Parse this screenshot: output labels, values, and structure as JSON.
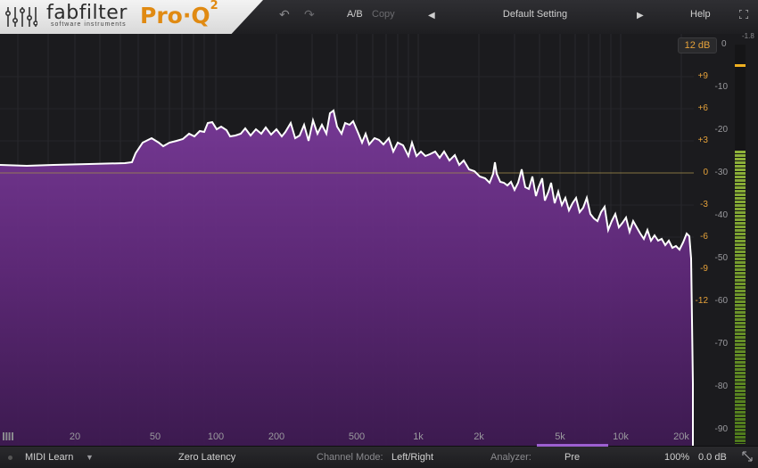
{
  "header": {
    "brand": "fabfilter",
    "brand_sub": "software instruments",
    "product": "Pro·Q",
    "product_version": "2",
    "ab_label": "A/B",
    "copy_label": "Copy",
    "preset_name": "Default Setting",
    "help_label": "Help"
  },
  "graph": {
    "range_button": "12 dB",
    "eq_scale": [
      "+9",
      "+6",
      "+3",
      "0",
      "-3",
      "-6",
      "-9",
      "-12"
    ],
    "analyzer_scale": [
      "-10",
      "-20",
      "-30",
      "-40",
      "-50",
      "-60",
      "-70",
      "-80",
      "-90"
    ],
    "scale_top": "0",
    "meter_peak": "-1.8",
    "freq_labels": [
      "20",
      "50",
      "100",
      "200",
      "500",
      "1k",
      "2k",
      "5k",
      "10k",
      "20k"
    ],
    "colors": {
      "spectrum_fill": "#6a2f86",
      "spectrum_line": "#ffffff",
      "accent": "#e08a12",
      "zero_line": "#a08a4a"
    }
  },
  "bottom": {
    "midi_learn": "MIDI Learn",
    "latency": "Zero Latency",
    "channel_mode_label": "Channel Mode:",
    "channel_mode_value": "Left/Right",
    "analyzer_label": "Analyzer:",
    "analyzer_value": "Pre",
    "zoom": "100%",
    "output_gain": "0.0 dB"
  },
  "icons": [
    "undo-icon",
    "redo-icon",
    "prev-arrow-icon",
    "next-arrow-icon",
    "fullscreen-icon",
    "piano-icon",
    "dropdown-icon",
    "resize-icon"
  ]
}
